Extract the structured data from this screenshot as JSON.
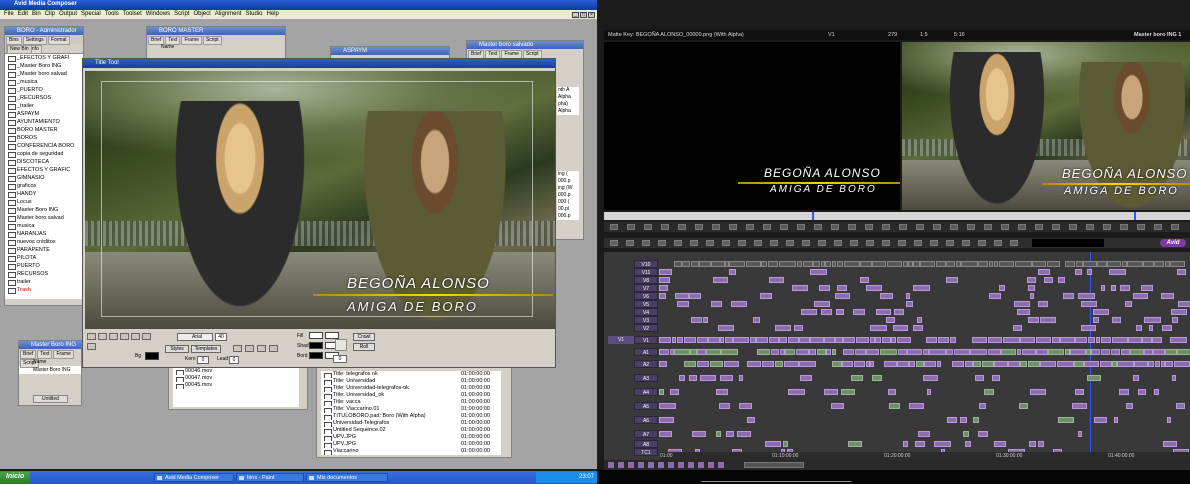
{
  "app": {
    "title": "Avid Media Composer",
    "menu": [
      "File",
      "Edit",
      "Bin",
      "Clip",
      "Output",
      "Special",
      "Tools",
      "Toolset",
      "Windows",
      "Script",
      "Object",
      "Alignment",
      "Studio",
      "Help"
    ],
    "win_minimize": "_",
    "win_restore": "□",
    "win_close": "×"
  },
  "project_window": {
    "title": "BORO - Administrador",
    "tabs": [
      "Bins",
      "Settings",
      "Format",
      "Usage",
      "Info"
    ],
    "new_bin_label": "New Bin",
    "bins": [
      "_EFECTOS Y GRAFI",
      "_Master Boro ING",
      "_Master boro salvad",
      "_musica",
      "_PUERTO",
      "_RECURSOS",
      "_trailer",
      "ASPAYM",
      "AYUNTAMIENTO",
      "BORO MASTER",
      "BOROS",
      "CONFERENCIA BORO",
      "copia de seguridad",
      "DISCOTECA",
      "EFECTOS Y GRAFIC",
      "GIMNASIO",
      "graficos",
      "HANDY",
      "Locus",
      "Master Boro ING",
      "Master boro salvad",
      "musica",
      "NARANJAS",
      "nuevos créditos",
      "PARAPENTE",
      "PILOTA",
      "PUERTO",
      "RECURSOS",
      "trailer",
      "Trash"
    ]
  },
  "boro_master_bin": {
    "title": "BORO MASTER",
    "tabs": [
      "Brief",
      "Text",
      "Frame",
      "Script"
    ],
    "name_col": "Name"
  },
  "aspaym_bin": {
    "title": "ASPAYM"
  },
  "master_boro_salvado_bin": {
    "title": "Master boro salvado",
    "tabs": [
      "Brief",
      "Text",
      "Frame",
      "Script"
    ]
  },
  "title_tool": {
    "title": "Title Tool",
    "caption_line1": "BEGOÑA ALONSO",
    "caption_line2": "AMIGA DE BORO",
    "font_name": "Arial",
    "font_size": "40",
    "styles_label": "Styles",
    "templates_label": "Templates",
    "kern_label": "Kern",
    "kern_value": "0",
    "lead_label": "Lead",
    "lead_value": "0",
    "fill_label": "Fill",
    "shad_label": "Shad",
    "bord_label": "Bord",
    "bg_label": "Bg",
    "crawl_label": "Crawl",
    "roll_label": "Roll",
    "depth_value": "0"
  },
  "master_boro_ing_bin": {
    "title": "Master Boro ING",
    "tabs": [
      "Brief",
      "Text",
      "Frame",
      "Script"
    ],
    "name_col": "Name",
    "row": "Master Boro ING",
    "untitled_label": "Untitled"
  },
  "clip_list_left": {
    "items": [
      "00049.mov",
      "00046.mov",
      "00047.mov",
      "00045.mov"
    ]
  },
  "clip_list_main": {
    "items": [
      {
        "name": "Title: telegrafos ok",
        "tc": "01:00:00:00"
      },
      {
        "name": "Title: Universidad",
        "tc": "01:00:00:00"
      },
      {
        "name": "Title: Universidad-telegrafos-ok",
        "tc": "01:00:00:00"
      },
      {
        "name": "Title: Universidad_ok",
        "tc": "01:00:00:00"
      },
      {
        "name": "Title: vacca",
        "tc": "01:00:00:00"
      },
      {
        "name": "Title: Viaccarino.01",
        "tc": "01:00:00:00"
      },
      {
        "name": "TITULOBORO.pad: Boro (With Alpha)",
        "tc": "01:00:00:00"
      },
      {
        "name": "Universidad-Telegrafos",
        "tc": "01:00:00:00"
      },
      {
        "name": "Untitled Sequence.02",
        "tc": "01:00:00:00"
      },
      {
        "name": "UPV.JPG",
        "tc": "01:00:00:00"
      },
      {
        "name": "UPV.JPG",
        "tc": "01:00:00:00"
      },
      {
        "name": "Viaccarino",
        "tc": "01:00:00:00"
      }
    ]
  },
  "right_partial_bin": {
    "lines": [
      "nth A",
      "Alpha",
      "pha)",
      "Alpha"
    ],
    "lines2": [
      "ing (",
      "000.p",
      "ing (W",
      "000.p",
      "000 (",
      "00.pl",
      "000.p"
    ]
  },
  "composer": {
    "clip_name": "Matte Key: BEGOÑA ALONSO_00000.png (With Alpha)",
    "v_label": "V1",
    "time1": "279",
    "time2": "1:5",
    "time3": "5:16",
    "sequence_name": "Master boro ING 1",
    "caption_line1": "BEGOÑA ALONSO",
    "caption_line2": "AMIGA DE BORO"
  },
  "timeline": {
    "brand": "Avid",
    "tracks": [
      "V10",
      "V11",
      "V8",
      "V7",
      "V6",
      "V5",
      "V4",
      "V3",
      "V2",
      "V1",
      "A1",
      "A2",
      "A3",
      "A4",
      "A5",
      "A6",
      "A7",
      "A8",
      "TC1"
    ],
    "record_track": "V1",
    "timecodes": [
      "01:00",
      "01:10:00:00",
      "01:20:00:00",
      "01:30:00:00",
      "01:40:00:00"
    ]
  },
  "taskbar": {
    "start": "Inicio",
    "items": [
      "Avid Media Composer",
      "bins - Paint",
      "Mis documentos"
    ],
    "clock": "23:07"
  },
  "colors": {
    "accent": "#0b3aa7",
    "track_purple": "#8c6bb1",
    "playhead": "#3355ff"
  }
}
